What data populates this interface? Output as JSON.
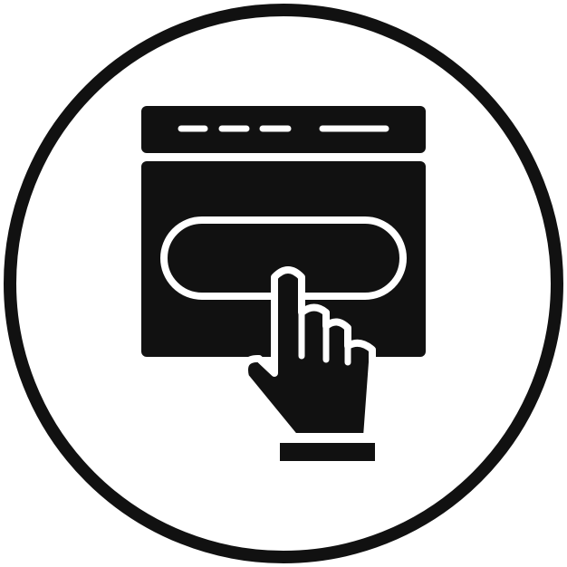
{
  "icon": {
    "name": "click-button-web-page-icon",
    "parts": [
      "outer-ring",
      "browser-window",
      "address-bar-dashes",
      "button-pill",
      "pointing-hand",
      "hand-base"
    ]
  },
  "colors": {
    "ink": "#111111",
    "background": "#ffffff"
  }
}
